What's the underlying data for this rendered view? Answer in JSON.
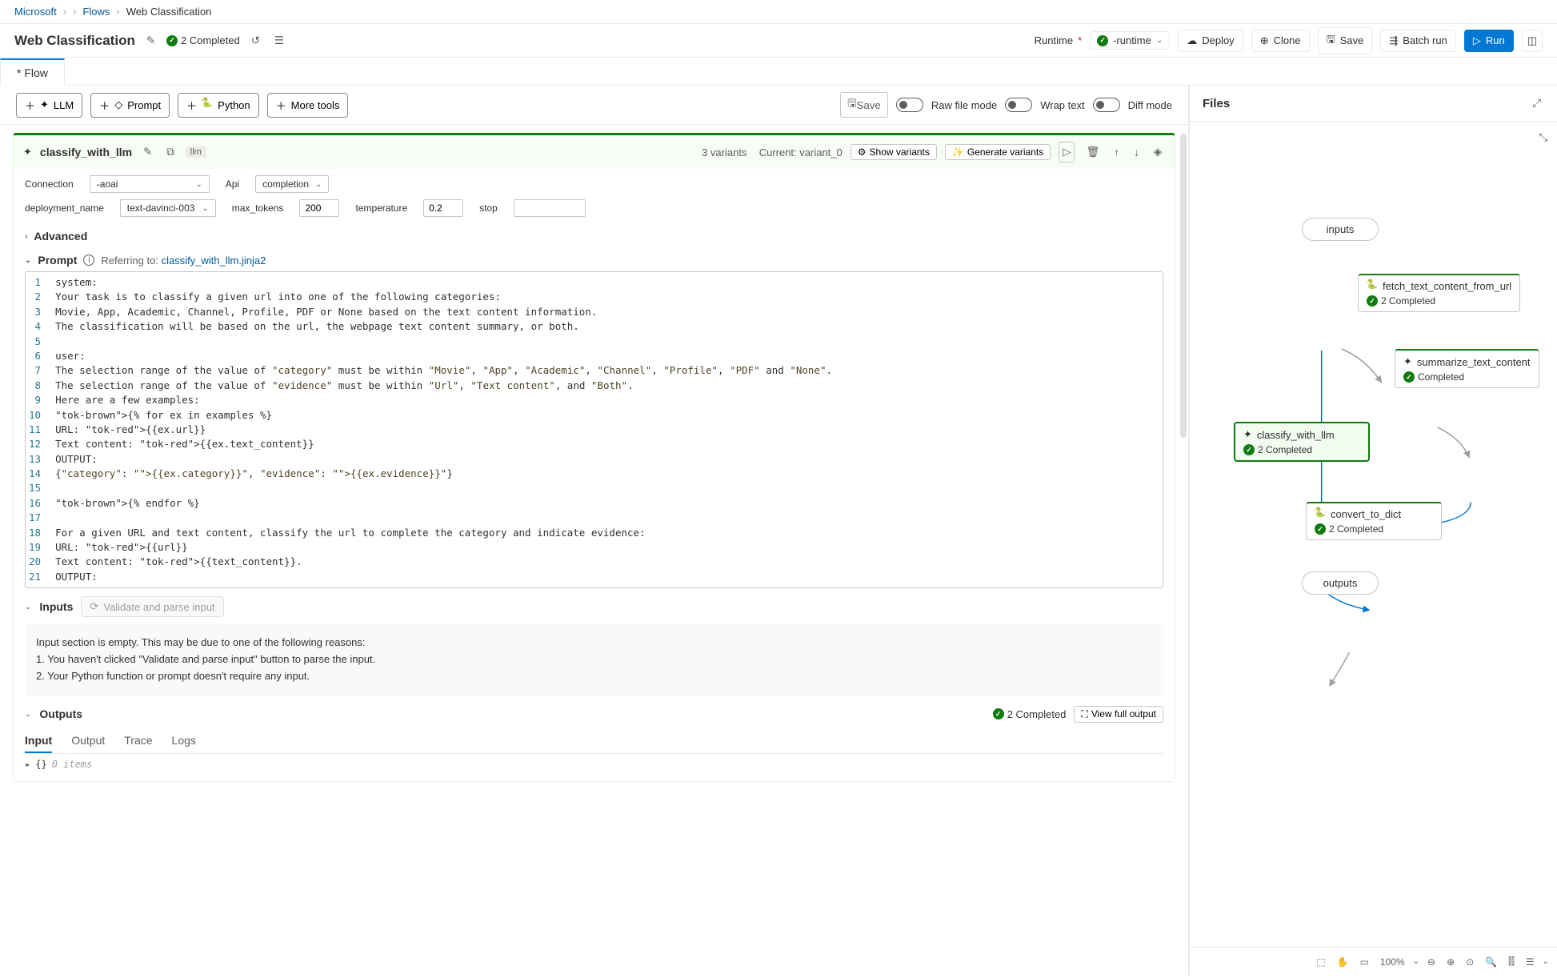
{
  "breadcrumb": {
    "root": "Microsoft",
    "l1": "Flows",
    "current": "Web Classification"
  },
  "header": {
    "title": "Web Classification",
    "status": "2 Completed",
    "runtime_label": "Runtime",
    "runtime_name": "-runtime",
    "deploy": "Deploy",
    "clone": "Clone",
    "save": "Save",
    "batch": "Batch run",
    "run": "Run"
  },
  "tabs": {
    "flow": "Flow"
  },
  "toolbar": {
    "llm": "LLM",
    "prompt": "Prompt",
    "python": "Python",
    "more": "More tools",
    "save": "Save",
    "toggle_raw": "Raw file mode",
    "toggle_wrap": "Wrap text",
    "toggle_diff": "Diff mode"
  },
  "node": {
    "name": "classify_with_llm",
    "tag": "llm",
    "variants_count": "3 variants",
    "current_variant": "Current: variant_0",
    "show_variants": "Show variants",
    "gen_variants": "Generate variants",
    "connection_label": "Connection",
    "connection_value": "-aoai",
    "api_label": "Api",
    "api_value": "completion",
    "deployment_label": "deployment_name",
    "deployment_value": "text-davinci-003",
    "max_tokens_label": "max_tokens",
    "max_tokens_value": "200",
    "temperature_label": "temperature",
    "temperature_value": "0.2",
    "stop_label": "stop",
    "stop_value": "",
    "advanced": "Advanced"
  },
  "prompt": {
    "section_label": "Prompt",
    "referring": "Referring to:",
    "file": "classify_with_llm.jinja2",
    "code": [
      "system:",
      "Your task is to classify a given url into one of the following categories:",
      "Movie, App, Academic, Channel, Profile, PDF or None based on the text content information.",
      "The classification will be based on the url, the webpage text content summary, or both.",
      "",
      "user:",
      "The selection range of the value of \"category\" must be within \"Movie\", \"App\", \"Academic\", \"Channel\", \"Profile\", \"PDF\" and \"None\".",
      "The selection range of the value of \"evidence\" must be within \"Url\", \"Text content\", and \"Both\".",
      "Here are a few examples:",
      "{% for ex in examples %}",
      "URL: {{ex.url}}",
      "Text content: {{ex.text_content}}",
      "OUTPUT:",
      "{\"category\": \"{{ex.category}}\", \"evidence\": \"{{ex.evidence}}\"}",
      "",
      "{% endfor %}",
      "",
      "For a given URL and text content, classify the url to complete the category and indicate evidence:",
      "URL: {{url}}",
      "Text content: {{text_content}}.",
      "OUTPUT:"
    ]
  },
  "inputs": {
    "header": "Inputs",
    "validate": "Validate and parse input",
    "msg_l1": "Input section is empty. This may be due to one of the following reasons:",
    "msg_l2": "1. You haven't clicked \"Validate and parse input\" button to parse the input.",
    "msg_l3": "2. Your Python function or prompt doesn't require any input."
  },
  "outputs": {
    "header": "Outputs",
    "status": "2 Completed",
    "view": "View full output",
    "tabs": {
      "input": "Input",
      "output": "Output",
      "trace": "Trace",
      "logs": "Logs"
    },
    "body_items": "0 items"
  },
  "files_panel": {
    "title": "Files"
  },
  "graph": {
    "inputs": "inputs",
    "fetch": {
      "label": "fetch_text_content_from_url",
      "status": "2 Completed"
    },
    "summarize": {
      "label": "summarize_text_content",
      "status": "Completed"
    },
    "classify": {
      "label": "classify_with_llm",
      "status": "2 Completed"
    },
    "convert": {
      "label": "convert_to_dict",
      "status": "2 Completed"
    },
    "outputs": "outputs"
  },
  "zoom": {
    "pct": "100%"
  }
}
